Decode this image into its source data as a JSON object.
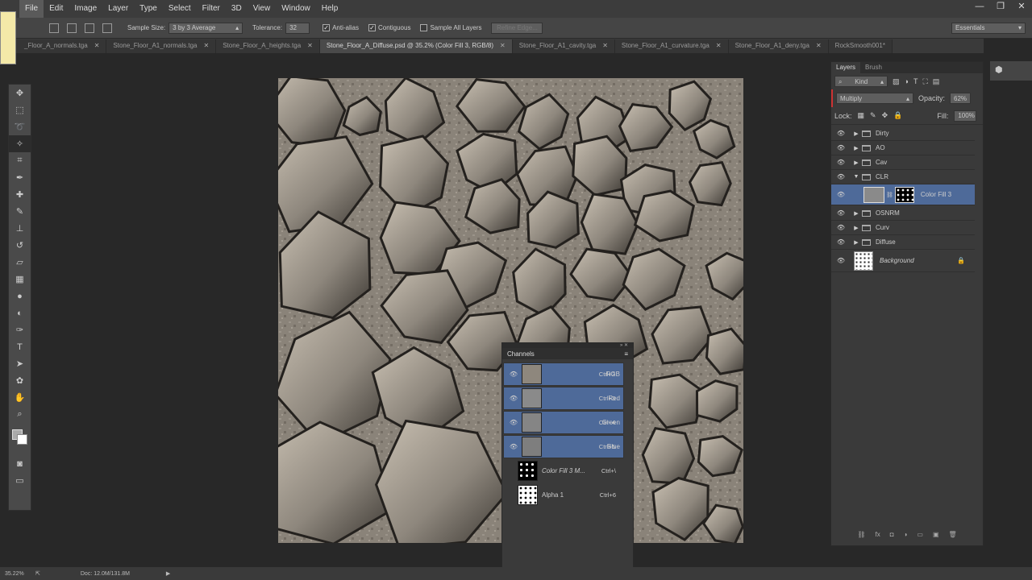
{
  "menu": [
    "File",
    "Edit",
    "Image",
    "Layer",
    "Type",
    "Select",
    "Filter",
    "3D",
    "View",
    "Window",
    "Help"
  ],
  "window_controls": [
    "—",
    "❐",
    "✕"
  ],
  "options": {
    "sample_size_label": "Sample Size:",
    "sample_size_value": "3 by 3 Average",
    "tolerance_label": "Tolerance:",
    "tolerance_value": "32",
    "anti_alias": "Anti-alias",
    "contiguous": "Contiguous",
    "sample_all": "Sample All Layers",
    "refine": "Refine Edge...",
    "workspace": "Essentials"
  },
  "tabs": [
    {
      "label": "_Floor_A_normals.tga"
    },
    {
      "label": "Stone_Floor_A1_normals.tga"
    },
    {
      "label": "Stone_Floor_A_heights.tga"
    },
    {
      "label": "Stone_Floor_A_Diffuse.psd @ 35.2% (Color Fill 3, RGB/8)"
    },
    {
      "label": "Stone_Floor_A1_cavity.tga"
    },
    {
      "label": "Stone_Floor_A1_curvature.tga"
    },
    {
      "label": "Stone_Floor_A1_deny.tga"
    },
    {
      "label": "RockSmooth001*"
    }
  ],
  "tab_close": "✕",
  "layers_panel": {
    "tabs": [
      "Layers",
      "Brush"
    ],
    "kind": "Kind",
    "blend_mode": "Multiply",
    "opacity_label": "Opacity:",
    "opacity_value": "62%",
    "lock_label": "Lock:",
    "fill_label": "Fill:",
    "fill_value": "100%",
    "layers": [
      {
        "name": "Dirty"
      },
      {
        "name": "AO"
      },
      {
        "name": "Cav"
      },
      {
        "name": "CLR"
      },
      {
        "name": "Color Fill 3"
      },
      {
        "name": "OSNRM"
      },
      {
        "name": "Curv"
      },
      {
        "name": "Diffuse"
      },
      {
        "name": "Background"
      }
    ]
  },
  "channels_panel": {
    "title": "Channels",
    "channels": [
      {
        "name": "RGB",
        "shortcut": "Ctrl+2"
      },
      {
        "name": "Red",
        "shortcut": "Ctrl+3"
      },
      {
        "name": "Green",
        "shortcut": "Ctrl+4"
      },
      {
        "name": "Blue",
        "shortcut": "Ctrl+5"
      },
      {
        "name": "Color Fill 3 M...",
        "shortcut": "Ctrl+\\"
      },
      {
        "name": "Alpha 1",
        "shortcut": "Ctrl+6"
      }
    ]
  },
  "status": {
    "zoom": "35.22%",
    "doc": "Doc: 12.0M/131.8M"
  },
  "colors": {
    "selection": "#4e6a99",
    "stone": "#807870"
  }
}
